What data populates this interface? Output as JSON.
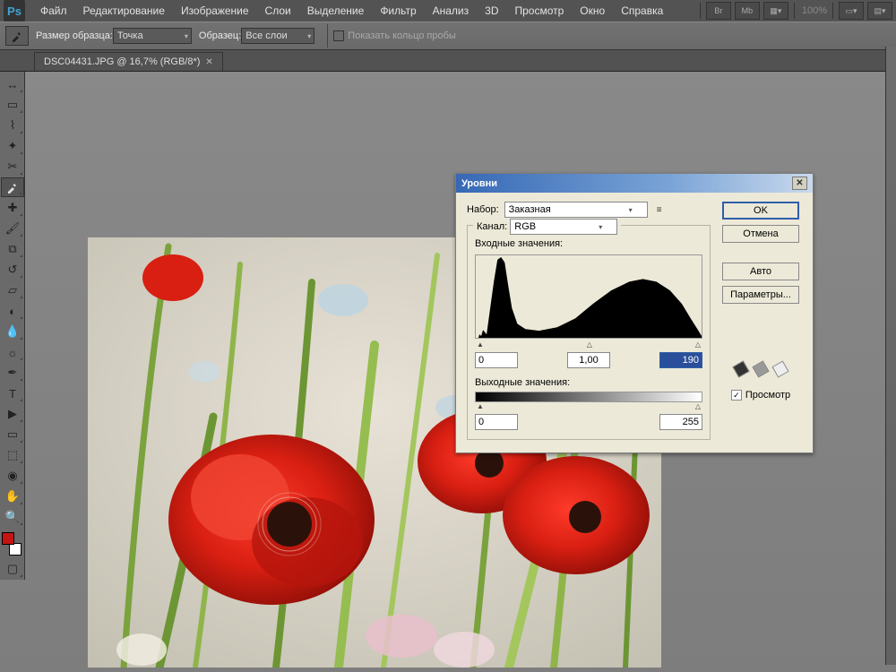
{
  "app": {
    "logo": "Ps",
    "zoom_pct": "100%"
  },
  "menu": [
    "Файл",
    "Редактирование",
    "Изображение",
    "Слои",
    "Выделение",
    "Фильтр",
    "Анализ",
    "3D",
    "Просмотр",
    "Окно",
    "Справка"
  ],
  "options_bar": {
    "sample_size_label": "Размер образца:",
    "sample_size_value": "Точка",
    "sample_label": "Образец:",
    "sample_value": "Все слои",
    "show_ring": "Показать кольцо пробы"
  },
  "tab": {
    "label": "DSC04431.JPG @ 16,7% (RGB/8*)"
  },
  "tools": [
    "move",
    "marquee",
    "lasso",
    "wand",
    "crop",
    "eyedrop",
    "heal",
    "brush",
    "stamp",
    "history-brush",
    "eraser",
    "gradient",
    "blur",
    "dodge",
    "pen",
    "type",
    "path-select",
    "shape",
    "3d",
    "3d-cam",
    "hand",
    "zoom"
  ],
  "swatch_fg": "#c41414",
  "dialog": {
    "title": "Уровни",
    "preset_label": "Набор:",
    "preset_value": "Заказная",
    "channel_label": "Канал:",
    "channel_value": "RGB",
    "input_label": "Входные значения:",
    "input_low": "0",
    "input_mid": "1,00",
    "input_high": "190",
    "output_label": "Выходные значения:",
    "output_low": "0",
    "output_high": "255",
    "btn_ok": "OK",
    "btn_cancel": "Отмена",
    "btn_auto": "Авто",
    "btn_params": "Параметры...",
    "preview": "Просмотр"
  }
}
